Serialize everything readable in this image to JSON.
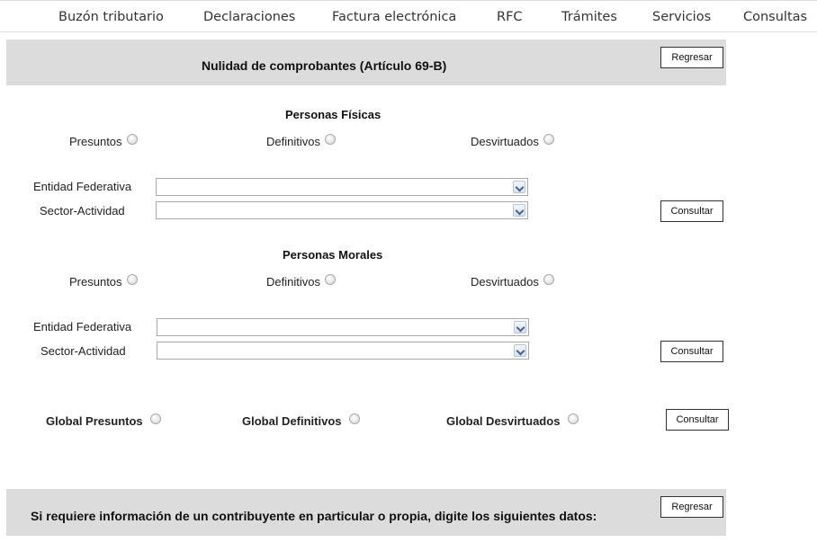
{
  "nav": {
    "items": [
      "Buzón tributario",
      "Declaraciones",
      "Factura electrónica",
      "RFC",
      "Trámites",
      "Servicios",
      "Consultas"
    ]
  },
  "header": {
    "title": "Nulidad de comprobantes (Artículo 69-B)",
    "back_button": "Regresar"
  },
  "fisicas": {
    "title": "Personas Físicas",
    "radio_presuntos": "Presuntos",
    "radio_definitivos": "Definitivos",
    "radio_desvirtuados": "Desvirtuados",
    "entidad_label": "Entidad Federativa",
    "entidad_value": "",
    "sector_label": "Sector-Actividad",
    "sector_value": "",
    "consultar": "Consultar"
  },
  "morales": {
    "title": "Personas Morales",
    "radio_presuntos": "Presuntos",
    "radio_definitivos": "Definitivos",
    "radio_desvirtuados": "Desvirtuados",
    "entidad_label": "Entidad Federativa",
    "entidad_value": "",
    "sector_label": "Sector-Actividad",
    "sector_value": "",
    "consultar": "Consultar"
  },
  "global": {
    "radio_presuntos": "Global Presuntos",
    "radio_definitivos": "Global Definitivos",
    "radio_desvirtuados": "Global Desvirtuados",
    "consultar": "Consultar"
  },
  "footer": {
    "title": "Si requiere información de un contribuyente en particular o propia, digite los siguientes datos:",
    "back_button": "Regresar"
  }
}
